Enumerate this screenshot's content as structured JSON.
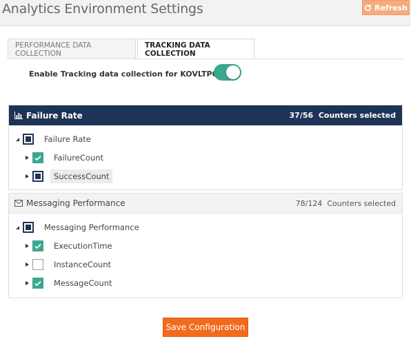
{
  "page": {
    "title": "Analytics Environment Settings"
  },
  "toolbar": {
    "refresh_label": "Refresh"
  },
  "tabs": [
    {
      "label": "PERFORMANCE DATA COLLECTION",
      "active": false
    },
    {
      "label": "TRACKING DATA COLLECTION",
      "active": true
    }
  ],
  "tracking": {
    "enable_label": "Enable Tracking data collection for KOVLTP012",
    "enabled": true
  },
  "sections": [
    {
      "title": "Failure Rate",
      "count": "37/56",
      "count_suffix": "Counters selected",
      "icon": "bar-chart-icon",
      "root": {
        "label": "Failure Rate",
        "state": "partial"
      },
      "children": [
        {
          "label": "FailureCount",
          "state": "checked"
        },
        {
          "label": "SuccessCount",
          "state": "partial"
        }
      ]
    },
    {
      "title": "Messaging Performance",
      "count": "78/124",
      "count_suffix": "Counters selected",
      "icon": "envelope-icon",
      "root": {
        "label": "Messaging Performance",
        "state": "partial"
      },
      "children": [
        {
          "label": "ExecutionTime",
          "state": "checked"
        },
        {
          "label": "InstanceCount",
          "state": "unchecked"
        },
        {
          "label": "MessageCount",
          "state": "checked"
        }
      ]
    }
  ],
  "footer": {
    "save_label": "Save Configuration"
  },
  "colors": {
    "navy": "#1e3456",
    "teal": "#3aa78f",
    "orange": "#f26b1d",
    "refresh": "#f6ab7f"
  }
}
